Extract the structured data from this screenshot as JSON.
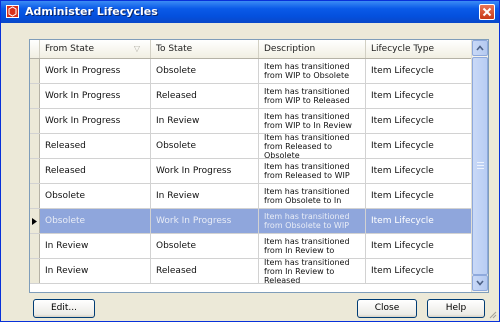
{
  "window": {
    "title": "Administer Lifecycles"
  },
  "columns": {
    "from_state": "From State",
    "to_state": "To State",
    "description": "Description",
    "lifecycle_type": "Lifecycle Type"
  },
  "rows": [
    {
      "from": "Work In Progress",
      "to": "Obsolete",
      "description": "Item has transitioned from WIP to Obsolete",
      "type": "Item Lifecycle",
      "selected": false
    },
    {
      "from": "Work In Progress",
      "to": "Released",
      "description": "Item has transitioned from WIP to Released",
      "type": "Item Lifecycle",
      "selected": false
    },
    {
      "from": "Work In Progress",
      "to": "In Review",
      "description": "Item has transitioned from WIP to In Review",
      "type": "Item Lifecycle",
      "selected": false
    },
    {
      "from": "Released",
      "to": "Obsolete",
      "description": "Item has transitioned from Released to Obsolete",
      "type": "Item Lifecycle",
      "selected": false
    },
    {
      "from": "Released",
      "to": "Work In Progress",
      "description": "Item has transitioned from Released to WIP",
      "type": "Item Lifecycle",
      "selected": false
    },
    {
      "from": "Obsolete",
      "to": "In Review",
      "description": "Item has transitioned from Obsolete to In",
      "type": "Item Lifecycle",
      "selected": false
    },
    {
      "from": "Obsolete",
      "to": "Work In Progress",
      "description": "Item has transitioned from Obsolete to WIP",
      "type": "Item Lifecycle",
      "selected": true
    },
    {
      "from": "In Review",
      "to": "Obsolete",
      "description": "Item has transitioned from In Review to",
      "type": "Item Lifecycle",
      "selected": false
    },
    {
      "from": "In Review",
      "to": "Released",
      "description": "Item has transitioned from In Review to Released",
      "type": "Item Lifecycle",
      "selected": false
    }
  ],
  "buttons": {
    "edit": "Edit...",
    "close": "Close",
    "help": "Help"
  },
  "icons": {
    "app": "lifecycle-app-icon",
    "close": "close-icon",
    "row_pointer": "row-pointer-icon",
    "sort": "sort-indicator-icon",
    "scroll_up": "chevron-up-icon",
    "scroll_down": "chevron-down-icon"
  },
  "colors": {
    "titlebar": "#0a5ae8",
    "selection": "#8fa6dc",
    "close_button": "#c83a18"
  }
}
